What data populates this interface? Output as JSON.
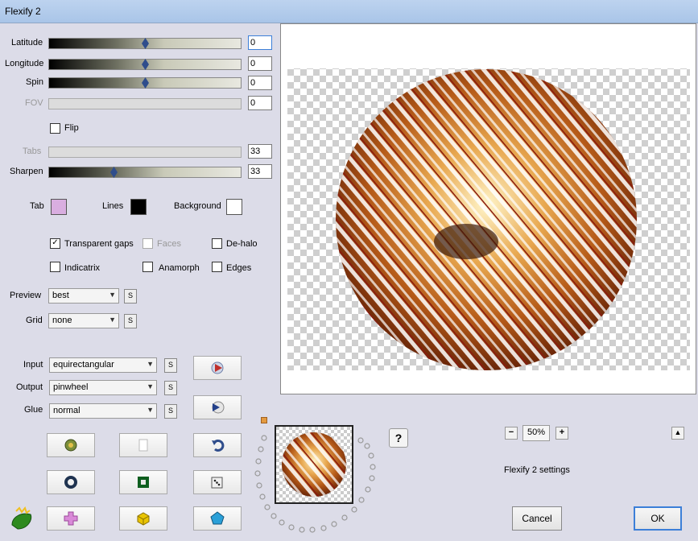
{
  "window": {
    "title": "Flexify 2"
  },
  "sliders": {
    "latitude": {
      "label": "Latitude",
      "value": "0"
    },
    "longitude": {
      "label": "Longitude",
      "value": "0"
    },
    "spin": {
      "label": "Spin",
      "value": "0"
    },
    "fov": {
      "label": "FOV",
      "value": "0"
    },
    "tabs": {
      "label": "Tabs",
      "value": "33"
    },
    "sharpen": {
      "label": "Sharpen",
      "value": "33"
    }
  },
  "flip": {
    "label": "Flip",
    "checked": false
  },
  "colors": {
    "tab": {
      "label": "Tab",
      "color": "#d9aee0"
    },
    "lines": {
      "label": "Lines",
      "color": "#000000"
    },
    "background": {
      "label": "Background",
      "color": "#ffffff"
    }
  },
  "options": {
    "transparent_gaps": {
      "label": "Transparent gaps",
      "checked": true
    },
    "faces": {
      "label": "Faces",
      "checked": false
    },
    "dehalo": {
      "label": "De-halo",
      "checked": false
    },
    "indicatrix": {
      "label": "Indicatrix",
      "checked": false
    },
    "anamorph": {
      "label": "Anamorph",
      "checked": false
    },
    "edges": {
      "label": "Edges",
      "checked": false
    }
  },
  "dropdowns": {
    "preview": {
      "label": "Preview",
      "value": "best"
    },
    "grid": {
      "label": "Grid",
      "value": "none"
    },
    "input": {
      "label": "Input",
      "value": "equirectangular"
    },
    "output": {
      "label": "Output",
      "value": "pinwheel"
    },
    "glue": {
      "label": "Glue",
      "value": "normal"
    }
  },
  "s_label": "S",
  "zoom": {
    "value": "50%",
    "minus": "−",
    "plus": "+"
  },
  "help": "?",
  "status_text": "Flexify 2 settings",
  "buttons": {
    "cancel": "Cancel",
    "ok": "OK"
  }
}
